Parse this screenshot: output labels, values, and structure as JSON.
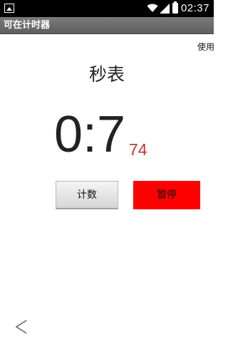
{
  "status_bar": {
    "time": "02:37",
    "icons": [
      "notification-image-icon",
      "wifi-icon",
      "signal-icon",
      "battery-icon"
    ]
  },
  "app": {
    "title": "可在计时器"
  },
  "toolbar": {
    "help_label": "使用"
  },
  "main": {
    "heading": "秒表",
    "time_main": "0:7",
    "time_fraction": "74"
  },
  "buttons": {
    "count_label": "计数",
    "pause_label": "暂停"
  },
  "nav": {
    "back_icon": "chevron-left-icon"
  },
  "colors": {
    "pause_button": "#ff0000",
    "fraction_text": "#c0392b",
    "title_bar": "#6b6b6b",
    "status_bar": "#000000"
  }
}
